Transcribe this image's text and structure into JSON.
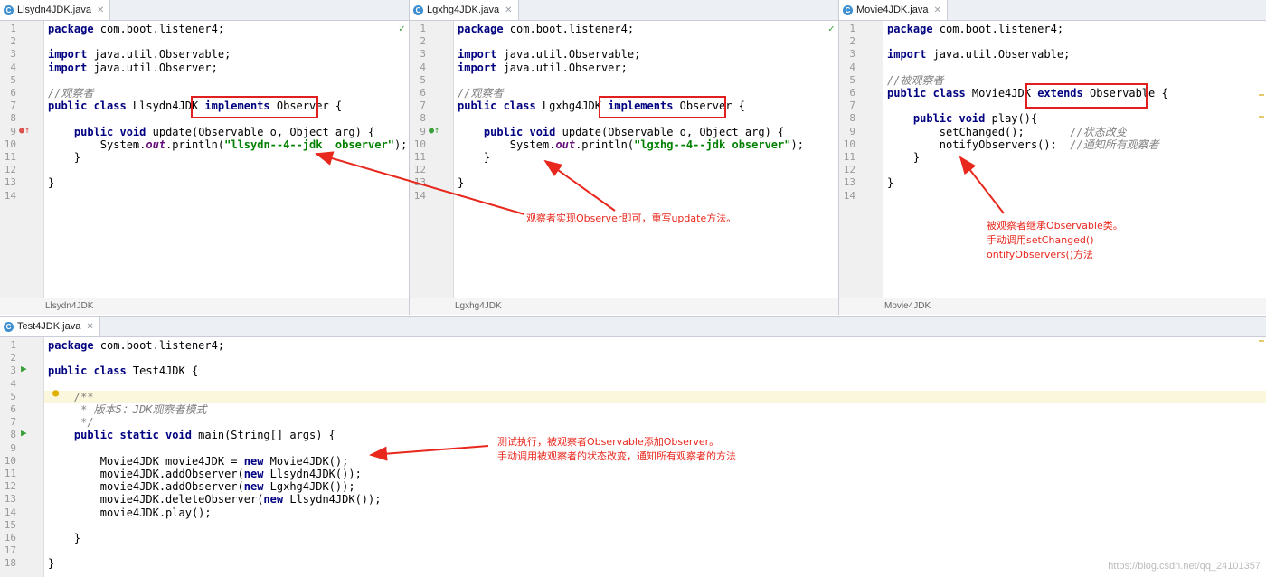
{
  "editors": [
    {
      "tab": "Llsydn4JDK.java",
      "status": "Llsydn4JDK",
      "line_numbers": [
        "1",
        "2",
        "3",
        "4",
        "5",
        "6",
        "7",
        "8",
        "9",
        "10",
        "11",
        "12",
        "13",
        "14"
      ],
      "lines": [
        [
          [
            "kw",
            "package"
          ],
          [
            "p",
            " com.boot.listener4;"
          ]
        ],
        [],
        [
          [
            "kw",
            "import"
          ],
          [
            "p",
            " java.util.Observable;"
          ]
        ],
        [
          [
            "kw",
            "import"
          ],
          [
            "p",
            " java.util.Observer;"
          ]
        ],
        [],
        [
          [
            "cm",
            "//观察者"
          ]
        ],
        [
          [
            "kw",
            "public class"
          ],
          [
            "p",
            " Llsydn4JDK "
          ],
          [
            "kw",
            "implements"
          ],
          [
            "p",
            " Observer {"
          ]
        ],
        [],
        [
          [
            "p",
            "    "
          ],
          [
            "kw",
            "public void"
          ],
          [
            "p",
            " update(Observable o, Object arg) {"
          ]
        ],
        [
          [
            "p",
            "        System."
          ],
          [
            "fld",
            "out"
          ],
          [
            "p",
            ".println("
          ],
          [
            "str",
            "\"llsydn--4--jdk  observer\""
          ],
          [
            "p",
            ");"
          ]
        ],
        [
          [
            "p",
            "    }"
          ]
        ],
        [],
        [
          [
            "p",
            "}"
          ]
        ],
        []
      ]
    },
    {
      "tab": "Lgxhg4JDK.java",
      "status": "Lgxhg4JDK",
      "line_numbers": [
        "1",
        "2",
        "3",
        "4",
        "5",
        "6",
        "7",
        "8",
        "9",
        "10",
        "11",
        "12",
        "13",
        "14"
      ],
      "lines": [
        [
          [
            "kw",
            "package"
          ],
          [
            "p",
            " com.boot.listener4;"
          ]
        ],
        [],
        [
          [
            "kw",
            "import"
          ],
          [
            "p",
            " java.util.Observable;"
          ]
        ],
        [
          [
            "kw",
            "import"
          ],
          [
            "p",
            " java.util.Observer;"
          ]
        ],
        [],
        [
          [
            "cm",
            "//观察者"
          ]
        ],
        [
          [
            "kw",
            "public class"
          ],
          [
            "p",
            " Lgxhg4JDK "
          ],
          [
            "kw",
            "implements"
          ],
          [
            "p",
            " Observer {"
          ]
        ],
        [],
        [
          [
            "p",
            "    "
          ],
          [
            "kw",
            "public void"
          ],
          [
            "p",
            " update(Observable o, Object arg) {"
          ]
        ],
        [
          [
            "p",
            "        System."
          ],
          [
            "fld",
            "out"
          ],
          [
            "p",
            ".println("
          ],
          [
            "str",
            "\"lgxhg--4--jdk observer\""
          ],
          [
            "p",
            ");"
          ]
        ],
        [
          [
            "p",
            "    }"
          ]
        ],
        [],
        [
          [
            "p",
            "}"
          ]
        ],
        []
      ]
    },
    {
      "tab": "Movie4JDK.java",
      "status": "Movie4JDK",
      "line_numbers": [
        "1",
        "2",
        "3",
        "4",
        "5",
        "6",
        "7",
        "8",
        "9",
        "10",
        "11",
        "12",
        "13",
        "14"
      ],
      "lines": [
        [
          [
            "kw",
            "package"
          ],
          [
            "p",
            " com.boot.listener4;"
          ]
        ],
        [],
        [
          [
            "kw",
            "import"
          ],
          [
            "p",
            " java.util.Observable;"
          ]
        ],
        [],
        [
          [
            "cm",
            "//被观察者"
          ]
        ],
        [
          [
            "kw",
            "public class"
          ],
          [
            "p",
            " Movie4JDK "
          ],
          [
            "kw",
            "extends"
          ],
          [
            "p",
            " Observable {"
          ]
        ],
        [],
        [
          [
            "p",
            "    "
          ],
          [
            "kw",
            "public void"
          ],
          [
            "p",
            " play(){"
          ]
        ],
        [
          [
            "p",
            "        setChanged();       "
          ],
          [
            "cm",
            "//状态改变"
          ]
        ],
        [
          [
            "p",
            "        notifyObservers();  "
          ],
          [
            "cm",
            "//通知所有观察者"
          ]
        ],
        [
          [
            "p",
            "    }"
          ]
        ],
        [],
        [
          [
            "p",
            "}"
          ]
        ],
        []
      ]
    },
    {
      "tab": "Test4JDK.java",
      "line_numbers": [
        "1",
        "2",
        "3",
        "4",
        "5",
        "6",
        "7",
        "8",
        "9",
        "10",
        "11",
        "12",
        "13",
        "14",
        "15",
        "16",
        "17",
        "18"
      ],
      "lines": [
        [
          [
            "kw",
            "package"
          ],
          [
            "p",
            " com.boot.listener4;"
          ]
        ],
        [],
        [
          [
            "kw",
            "public class"
          ],
          [
            "p",
            " Test4JDK {"
          ]
        ],
        [],
        [
          [
            "p",
            "    "
          ],
          [
            "cm",
            "/**"
          ]
        ],
        [
          [
            "p",
            "     "
          ],
          [
            "cm",
            "* 版本5：JDK观察者模式"
          ]
        ],
        [
          [
            "p",
            "     "
          ],
          [
            "cm",
            "*/"
          ]
        ],
        [
          [
            "p",
            "    "
          ],
          [
            "kw",
            "public static void"
          ],
          [
            "p",
            " main(String[] args) {"
          ]
        ],
        [],
        [
          [
            "p",
            "        Movie4JDK movie4JDK = "
          ],
          [
            "kw",
            "new"
          ],
          [
            "p",
            " Movie4JDK();"
          ]
        ],
        [
          [
            "p",
            "        movie4JDK.addObserver("
          ],
          [
            "kw",
            "new"
          ],
          [
            "p",
            " Llsydn4JDK());"
          ]
        ],
        [
          [
            "p",
            "        movie4JDK.addObserver("
          ],
          [
            "kw",
            "new"
          ],
          [
            "p",
            " Lgxhg4JDK());"
          ]
        ],
        [
          [
            "p",
            "        movie4JDK.deleteObserver("
          ],
          [
            "kw",
            "new"
          ],
          [
            "p",
            " Llsydn4JDK());"
          ]
        ],
        [
          [
            "p",
            "        movie4JDK.play();"
          ]
        ],
        [],
        [
          [
            "p",
            "    }"
          ]
        ],
        [],
        [
          [
            "p",
            "}"
          ]
        ]
      ]
    }
  ],
  "annotations": {
    "observer": "观察者实现Observer即可，重写update方法。",
    "observable": [
      "被观察者继承Observable类。",
      "手动调用setChanged()",
      "ontifyObservers()方法"
    ],
    "test": [
      "测试执行，被观察者Observable添加Observer。",
      "手动调用被观察者的状态改变，通知所有观察者的方法"
    ]
  },
  "watermark": "https://blog.csdn.net/qq_24101357",
  "colors": {
    "annotation": "#e8281d",
    "keyword": "#000080",
    "comment": "#808080",
    "string": "#008000"
  }
}
